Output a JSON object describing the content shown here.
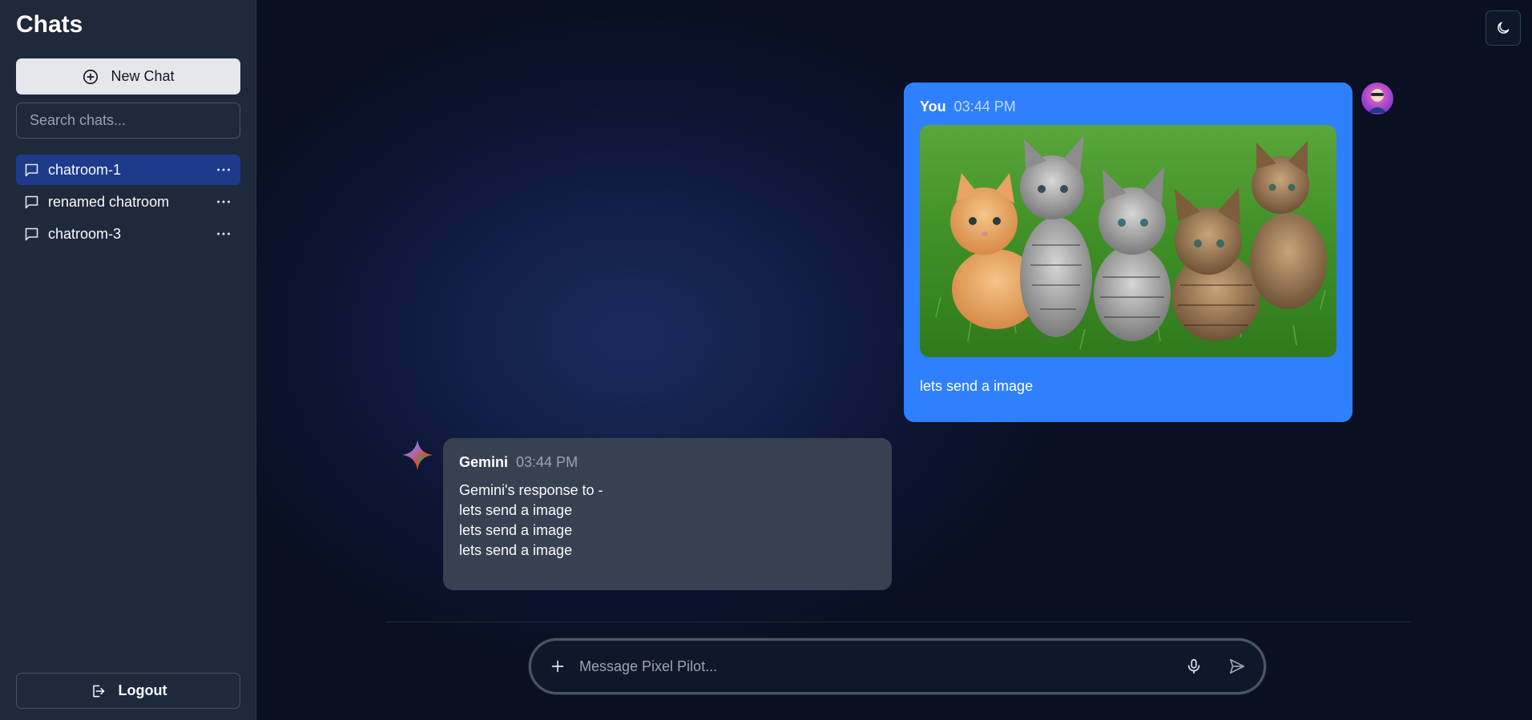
{
  "sidebar": {
    "title": "Chats",
    "new_chat_label": "New Chat",
    "search_placeholder": "Search chats...",
    "chats": [
      {
        "label": "chatroom-1",
        "active": true
      },
      {
        "label": "renamed chatroom",
        "active": false
      },
      {
        "label": "chatroom-3",
        "active": false
      }
    ],
    "logout_label": "Logout"
  },
  "messages": {
    "user": {
      "name": "You",
      "time": "03:44 PM",
      "text": "lets send a image",
      "image": "kittens-on-grass"
    },
    "bot": {
      "name": "Gemini",
      "time": "03:44 PM",
      "lines": [
        "Gemini's response to -",
        "lets send a image",
        "lets send a image",
        "lets send a image"
      ]
    }
  },
  "composer": {
    "placeholder": "Message Pixel Pilot..."
  },
  "icons": {
    "theme_toggle": "moon-icon",
    "new_chat": "plus-circle-icon",
    "chat_item": "message-square-icon",
    "chat_menu": "more-horizontal-icon",
    "logout": "logout-icon",
    "attach": "plus-icon",
    "mic": "mic-icon",
    "send": "send-icon"
  },
  "colors": {
    "sidebar_bg": "#1e293b",
    "active_chat": "#1e3a8a",
    "user_bubble": "#2f80ff",
    "bot_bubble": "#374151"
  }
}
